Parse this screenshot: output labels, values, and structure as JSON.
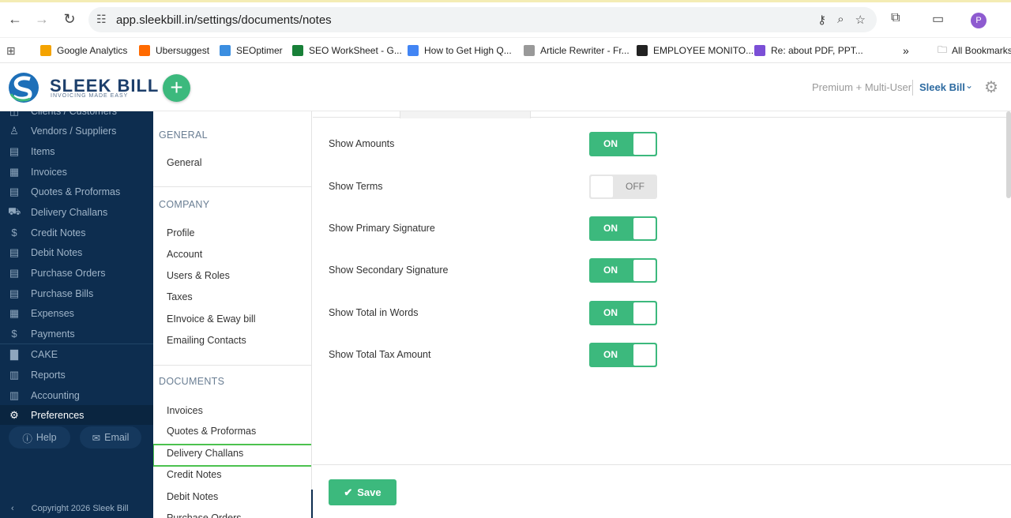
{
  "browser": {
    "url": "app.sleekbill.in/settings/documents/notes",
    "profile_initial": "P",
    "bookmarks": [
      {
        "label": "Google Analytics",
        "color": "#f4a300"
      },
      {
        "label": "Ubersuggest",
        "color": "#ff6a00"
      },
      {
        "label": "SEOptimer",
        "color": "#3b8ee0"
      },
      {
        "label": "SEO WorkSheet - G...",
        "color": "#188038"
      },
      {
        "label": "How to Get High Q...",
        "color": "#4285f4"
      },
      {
        "label": "Article Rewriter - Fr...",
        "color": "#999999"
      },
      {
        "label": "EMPLOYEE MONITO...",
        "color": "#222222"
      },
      {
        "label": "Re: about PDF, PPT...",
        "color": "#7b4fd6"
      }
    ],
    "more_label": "»",
    "all_bookmarks": "All Bookmarks"
  },
  "header": {
    "logo_name": "SLEEK BILL",
    "logo_tagline": "INVOICING MADE EASY",
    "add_label": "+",
    "plan": "Premium + Multi-User",
    "company": "Sleek Bill"
  },
  "sidebar": {
    "items": [
      {
        "label": "Clients / Customers",
        "icon": "◫"
      },
      {
        "label": "Vendors / Suppliers",
        "icon": "♙"
      },
      {
        "label": "Items",
        "icon": "▤"
      },
      {
        "label": "Invoices",
        "icon": "▦"
      },
      {
        "label": "Quotes & Proformas",
        "icon": "▤"
      },
      {
        "label": "Delivery Challans",
        "icon": "⛟"
      },
      {
        "label": "Credit Notes",
        "icon": "$"
      },
      {
        "label": "Debit Notes",
        "icon": "▤"
      },
      {
        "label": "Purchase Orders",
        "icon": "▤"
      },
      {
        "label": "Purchase Bills",
        "icon": "▤"
      },
      {
        "label": "Expenses",
        "icon": "▦"
      },
      {
        "label": "Payments",
        "icon": "$"
      },
      {
        "label": "CAKE",
        "icon": "▇"
      },
      {
        "label": "Reports",
        "icon": "▥"
      },
      {
        "label": "Accounting",
        "icon": "▥"
      },
      {
        "label": "Preferences",
        "icon": "⚙"
      }
    ],
    "help": "Help",
    "email": "Email",
    "copyright": "Copyright 2026 Sleek Bill"
  },
  "subnav": {
    "general_head": "GENERAL",
    "general_items": [
      "General"
    ],
    "company_head": "COMPANY",
    "company_items": [
      "Profile",
      "Account",
      "Users & Roles",
      "Taxes",
      "EInvoice & Eway bill",
      "Emailing Contacts"
    ],
    "documents_head": "DOCUMENTS",
    "documents_items": [
      "Invoices",
      "Quotes & Proformas",
      "Delivery Challans",
      "Credit Notes",
      "Debit Notes",
      "Purchase Orders"
    ]
  },
  "settings": {
    "rows": [
      {
        "label": "Show Amounts",
        "state": "ON"
      },
      {
        "label": "Show Terms",
        "state": "OFF"
      },
      {
        "label": "Show Primary Signature",
        "state": "ON"
      },
      {
        "label": "Show Secondary Signature",
        "state": "ON"
      },
      {
        "label": "Show Total in Words",
        "state": "ON"
      },
      {
        "label": "Show Total Tax Amount",
        "state": "ON"
      }
    ],
    "save_label": "Save"
  },
  "colors": {
    "accent_green": "#3cb97d",
    "sidebar_bg": "#0d2d4f",
    "highlight_border": "#4cc24f"
  }
}
